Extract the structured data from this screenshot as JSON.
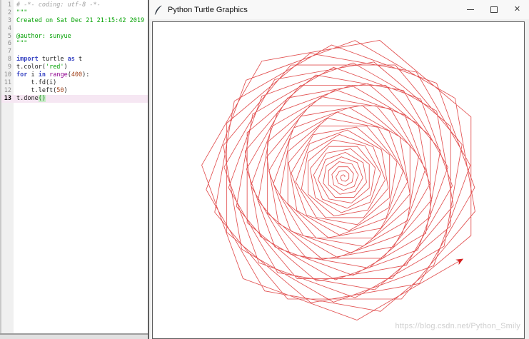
{
  "window": {
    "title": "Python Turtle Graphics",
    "controls": {
      "minimize": "minimize",
      "maximize": "maximize",
      "close": "✕"
    }
  },
  "editor": {
    "lines": [
      {
        "n": 1,
        "tokens": [
          {
            "t": "com",
            "v": "# -*- coding: utf-8 -*-"
          }
        ]
      },
      {
        "n": 2,
        "tokens": [
          {
            "t": "str",
            "v": "\"\"\""
          }
        ]
      },
      {
        "n": 3,
        "tokens": [
          {
            "t": "str",
            "v": "Created on Sat Dec 21 21:15:42 2019"
          }
        ]
      },
      {
        "n": 4,
        "tokens": []
      },
      {
        "n": 5,
        "tokens": [
          {
            "t": "str",
            "v": "@author: sunyue"
          }
        ]
      },
      {
        "n": 6,
        "tokens": [
          {
            "t": "str",
            "v": "\"\"\""
          }
        ]
      },
      {
        "n": 7,
        "tokens": []
      },
      {
        "n": 8,
        "tokens": [
          {
            "t": "kw",
            "v": "import"
          },
          {
            "t": "txt",
            "v": " turtle "
          },
          {
            "t": "kw",
            "v": "as"
          },
          {
            "t": "txt",
            "v": " t"
          }
        ]
      },
      {
        "n": 9,
        "tokens": [
          {
            "t": "txt",
            "v": "t.color("
          },
          {
            "t": "str",
            "v": "'red'"
          },
          {
            "t": "txt",
            "v": ")"
          }
        ]
      },
      {
        "n": 10,
        "tokens": [
          {
            "t": "kw",
            "v": "for"
          },
          {
            "t": "txt",
            "v": " i "
          },
          {
            "t": "kw",
            "v": "in"
          },
          {
            "t": "txt",
            "v": " "
          },
          {
            "t": "builtin",
            "v": "range"
          },
          {
            "t": "txt",
            "v": "("
          },
          {
            "t": "num",
            "v": "400"
          },
          {
            "t": "txt",
            "v": "):"
          }
        ]
      },
      {
        "n": 11,
        "tokens": [
          {
            "t": "txt",
            "v": "    t.fd(i)"
          }
        ]
      },
      {
        "n": 12,
        "tokens": [
          {
            "t": "txt",
            "v": "    t.left("
          },
          {
            "t": "num",
            "v": "50"
          },
          {
            "t": "txt",
            "v": ")"
          }
        ]
      },
      {
        "n": 13,
        "current": true,
        "tokens": [
          {
            "t": "txt",
            "v": "t.done"
          },
          {
            "t": "paren",
            "v": "()"
          }
        ]
      }
    ]
  },
  "turtle_sim": {
    "type": "turtle-spiral",
    "pen_color": "#e04848",
    "cursor_color": "#d42020",
    "forward_step": "i",
    "turn_left_deg": 50,
    "loop_range": 400,
    "iterations_drawn": 232,
    "fit_width": 417,
    "fit_height": 392
  },
  "watermark": {
    "text": "https://blog.csdn.net/Python_Smily"
  }
}
